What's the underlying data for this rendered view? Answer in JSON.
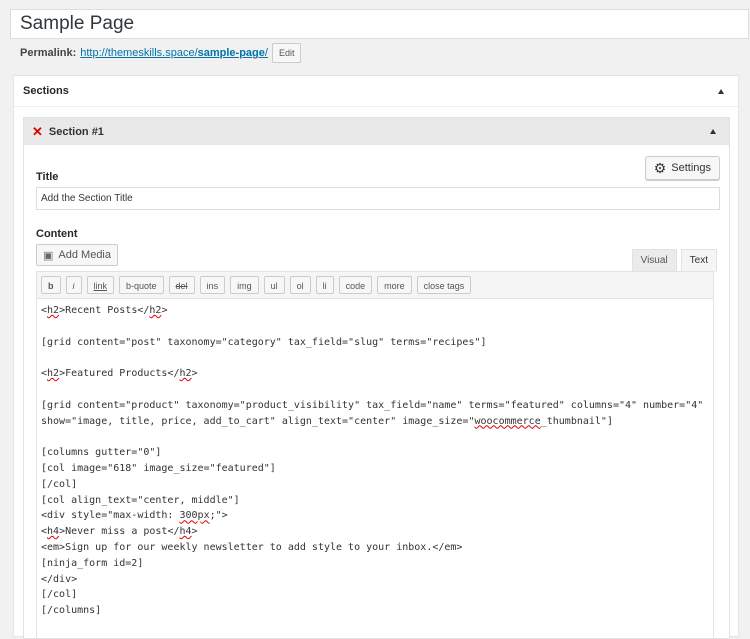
{
  "page_title": "Sample Page",
  "permalink": {
    "label": "Permalink:",
    "url_base": "http://themeskills.space/",
    "url_slug": "sample-page",
    "url_end": "/",
    "edit_label": "Edit"
  },
  "sections_box": {
    "title": "Sections",
    "section": {
      "title": "Section #1",
      "settings_label": "Settings",
      "title_label": "Title",
      "title_value": "Add the Section Title",
      "content_label": "Content",
      "add_media_label": "Add Media",
      "tabs": [
        "Visual",
        "Text"
      ],
      "active_tab": "Text",
      "toolbar": [
        "b",
        "i",
        "link",
        "b-quote",
        "del",
        "ins",
        "img",
        "ul",
        "ol",
        "li",
        "code",
        "more",
        "close tags"
      ]
    }
  },
  "code_lines": [
    [
      "<",
      {
        "sp": "h2"
      },
      ">Recent Posts</",
      {
        "sp": "h2"
      },
      ">"
    ],
    [
      ""
    ],
    [
      "[grid content=\"post\" taxonomy=\"category\" tax_field=\"slug\" terms=\"recipes\"]"
    ],
    [
      ""
    ],
    [
      "<",
      {
        "sp": "h2"
      },
      ">Featured Products</",
      {
        "sp": "h2"
      },
      ">"
    ],
    [
      ""
    ],
    [
      "[grid content=\"product\" taxonomy=\"product_visibility\" tax_field=\"name\" terms=\"featured\" columns=\"4\" number=\"4\""
    ],
    [
      "show=\"image, title, price, add_to_cart\" align_text=\"center\" image_size=\"",
      {
        "sp": "woocommerce"
      },
      "_thumbnail\"]"
    ],
    [
      ""
    ],
    [
      "[columns gutter=\"0\"]"
    ],
    [
      "[col image=\"618\" image_size=\"featured\"]"
    ],
    [
      "[/col]"
    ],
    [
      "[col align_text=\"center, middle\"]"
    ],
    [
      "<div style=\"max-width: ",
      {
        "sp": "300px"
      },
      ";\">"
    ],
    [
      "<",
      {
        "sp": "h4"
      },
      ">Never miss a post</",
      {
        "sp": "h4"
      },
      ">"
    ],
    [
      "<em>Sign up for our weekly newsletter to add style to your inbox.</em>"
    ],
    [
      "[ninja_form id=2]"
    ],
    [
      "</div>"
    ],
    [
      "[/col]"
    ],
    [
      "[/columns]"
    ]
  ]
}
